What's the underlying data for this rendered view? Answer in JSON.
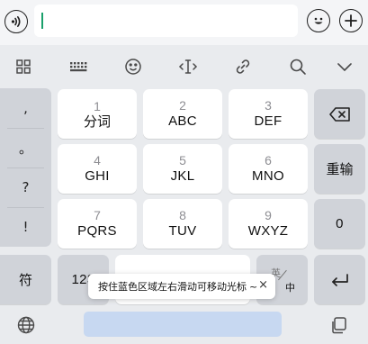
{
  "input_bar": {
    "text_value": "",
    "left_icon": "voice-wave-icon",
    "right_icons": [
      "emoji-icon",
      "plus-icon"
    ]
  },
  "toolbar": {
    "icons": [
      "grid-icon",
      "keyboard-icon",
      "emoji-icon",
      "cursor-move-icon",
      "link-icon",
      "search-icon",
      "chevron-down-icon"
    ]
  },
  "punctuation": [
    ",",
    "。",
    "?",
    "!"
  ],
  "keys": [
    {
      "num": "1",
      "label": "分词"
    },
    {
      "num": "2",
      "label": "ABC"
    },
    {
      "num": "3",
      "label": "DEF"
    },
    {
      "num": "4",
      "label": "GHI"
    },
    {
      "num": "5",
      "label": "JKL"
    },
    {
      "num": "6",
      "label": "MNO"
    },
    {
      "num": "7",
      "label": "PQRS"
    },
    {
      "num": "8",
      "label": "TUV"
    },
    {
      "num": "9",
      "label": "WXYZ"
    }
  ],
  "right_column": {
    "delete_icon": "backspace-icon",
    "reenter": "重输",
    "zero": "0",
    "enter_icon": "return-icon"
  },
  "bottom_row": {
    "symbol": "符",
    "numeric": "123",
    "lang_top": "英",
    "lang_bottom": "中"
  },
  "tooltip": {
    "text": "按住蓝色区域左右滑动可移动光标",
    "suffix": "~",
    "close": "×"
  },
  "bottom_bar": {
    "globe_icon": "globe-icon",
    "clipboard_icon": "clipboard-icon"
  },
  "colors": {
    "background": "#e9ebee",
    "key": "#ffffff",
    "function_key": "#d0d3d9",
    "space_bar": "#c7d8f1",
    "caret": "#1aa06b"
  }
}
